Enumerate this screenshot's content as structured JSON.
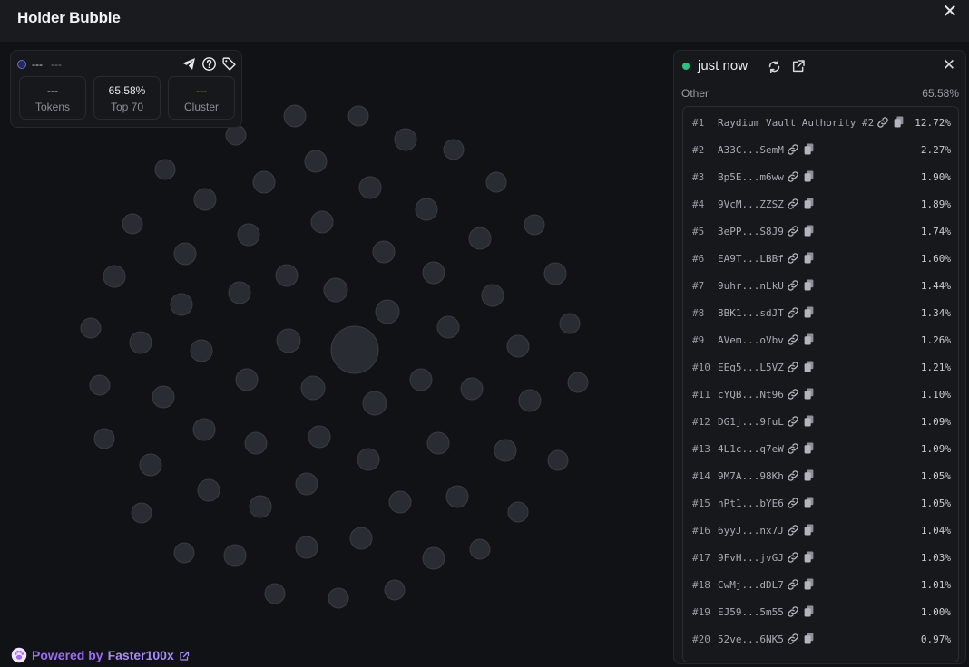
{
  "window": {
    "title": "Holder Bubble"
  },
  "stats": {
    "name": "---",
    "sub": "---",
    "boxes": [
      {
        "value": "---",
        "label": "Tokens"
      },
      {
        "value": "65.58%",
        "label": "Top 70"
      },
      {
        "value": "---",
        "label": "Cluster"
      }
    ]
  },
  "holders_panel": {
    "status": "just now",
    "group_label": "Other",
    "group_pct": "65.58%",
    "rows": [
      {
        "rank": "#1",
        "address": "Raydium Vault Authority #2",
        "pct": "12.72%"
      },
      {
        "rank": "#2",
        "address": "A33C...SemM",
        "pct": "2.27%"
      },
      {
        "rank": "#3",
        "address": "Bp5E...m6ww",
        "pct": "1.90%"
      },
      {
        "rank": "#4",
        "address": "9VcM...ZZSZ",
        "pct": "1.89%"
      },
      {
        "rank": "#5",
        "address": "3ePP...S8J9",
        "pct": "1.74%"
      },
      {
        "rank": "#6",
        "address": "EA9T...LBBf",
        "pct": "1.60%"
      },
      {
        "rank": "#7",
        "address": "9uhr...nLkU",
        "pct": "1.44%"
      },
      {
        "rank": "#8",
        "address": "8BK1...sdJT",
        "pct": "1.34%"
      },
      {
        "rank": "#9",
        "address": "AVem...oVbv",
        "pct": "1.26%"
      },
      {
        "rank": "#10",
        "address": "EEq5...L5VZ",
        "pct": "1.21%"
      },
      {
        "rank": "#11",
        "address": "cYQB...Nt96",
        "pct": "1.10%"
      },
      {
        "rank": "#12",
        "address": "DG1j...9fuL",
        "pct": "1.09%"
      },
      {
        "rank": "#13",
        "address": "4L1c...q7eW",
        "pct": "1.09%"
      },
      {
        "rank": "#14",
        "address": "9M7A...98Kh",
        "pct": "1.05%"
      },
      {
        "rank": "#15",
        "address": "nPt1...bYE6",
        "pct": "1.05%"
      },
      {
        "rank": "#16",
        "address": "6yyJ...nx7J",
        "pct": "1.04%"
      },
      {
        "rank": "#17",
        "address": "9FvH...jvGJ",
        "pct": "1.03%"
      },
      {
        "rank": "#18",
        "address": "CwMj...dDL7",
        "pct": "1.01%"
      },
      {
        "rank": "#19",
        "address": "EJ59...5m55",
        "pct": "1.00%"
      },
      {
        "rank": "#20",
        "address": "52ve...6NK5",
        "pct": "0.97%"
      }
    ]
  },
  "footer": {
    "prefix": "Powered by",
    "brand": "Faster100x"
  },
  "colors": {
    "bubble_fill": "#2a2c33",
    "bubble_stroke": "#3a3c44",
    "accent": "#9b59f6",
    "status": "#2cc080"
  },
  "icons": [
    "close-icon",
    "telegram-icon",
    "help-icon",
    "tag-icon",
    "refresh-icon",
    "external-link-icon",
    "link-icon",
    "copy-icon",
    "paw-icon"
  ]
}
